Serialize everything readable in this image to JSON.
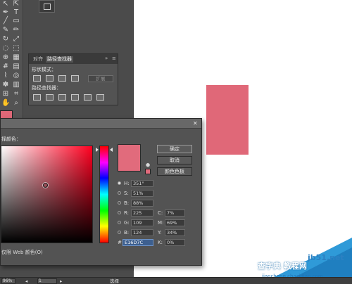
{
  "app": {
    "accent": "#e06878"
  },
  "toolbar": {
    "tools": [
      "selection-tool",
      "direct-selection-tool",
      "pen-tool",
      "type-tool",
      "line-tool",
      "rectangle-tool",
      "paintbrush-tool",
      "pencil-tool",
      "rotate-tool",
      "scale-tool",
      "warp-tool",
      "free-transform-tool",
      "shape-builder-tool",
      "perspective-tool",
      "mesh-tool",
      "gradient-tool",
      "eyedropper-tool",
      "blend-tool",
      "symbol-sprayer-tool",
      "graph-tool",
      "artboard-tool",
      "slice-tool",
      "hand-tool",
      "zoom-tool"
    ],
    "fill_color": "#e06878"
  },
  "pathfinder": {
    "tabs": [
      "对齐",
      "路径查找器"
    ],
    "active_tab": 1,
    "shape_modes_label": "形状模式：",
    "expand_label": "扩展",
    "pathfinders_label": "路径查找器："
  },
  "canvas": {
    "rect_color": "#e06878"
  },
  "color_picker": {
    "prompt": "择颜色：",
    "preview_color": "#e16b7c",
    "ok_label": "确定",
    "cancel_label": "取消",
    "swatches_label": "颜色色板",
    "fields": {
      "H": {
        "label": "H:",
        "value": "351°"
      },
      "S": {
        "label": "S:",
        "value": "51%"
      },
      "B": {
        "label": "B:",
        "value": "88%"
      },
      "R": {
        "label": "R:",
        "value": "225"
      },
      "G": {
        "label": "G:",
        "value": "109"
      },
      "Bl": {
        "label": "B:",
        "value": "124"
      },
      "C": {
        "label": "C:",
        "value": "7%"
      },
      "M": {
        "label": "M:",
        "value": "69%"
      },
      "Y": {
        "label": "Y:",
        "value": "34%"
      },
      "K": {
        "label": "K:",
        "value": "0%"
      },
      "hex": {
        "label": "#",
        "value": "E16D7C"
      }
    },
    "only_web_label": "仅限 Web 颜色(O)"
  },
  "statusbar": {
    "zoom": "96%",
    "artboard": "1",
    "tool_name": "选择"
  },
  "watermark": {
    "site": "jb51.net",
    "title": "查字典 教程网",
    "url": "jiaocheng.chazidian.com"
  }
}
